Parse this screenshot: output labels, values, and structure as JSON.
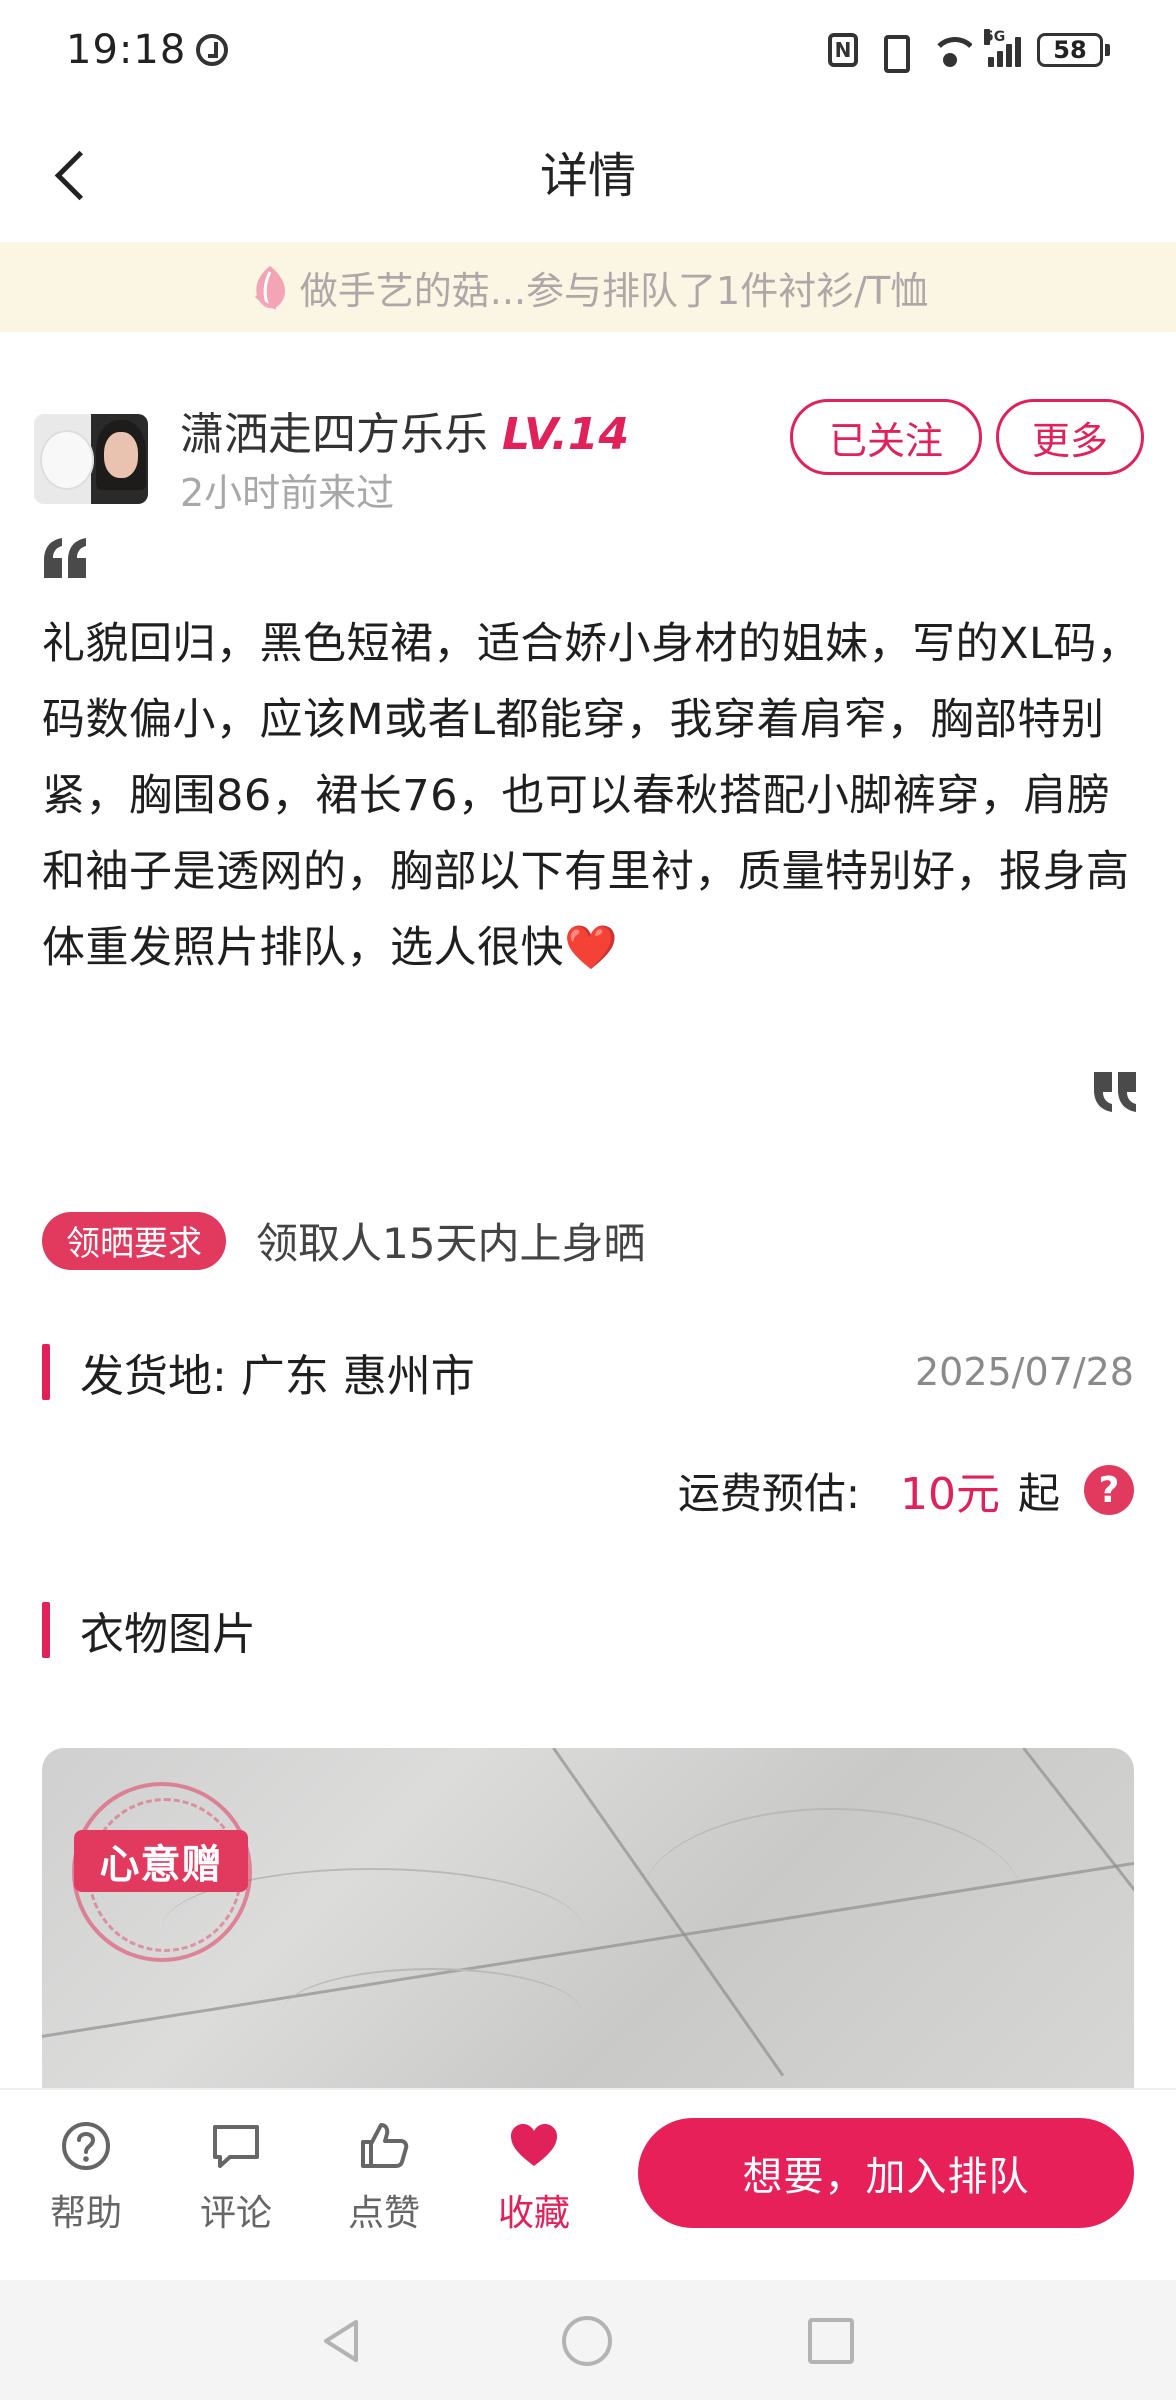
{
  "status_bar": {
    "time": "19:18",
    "network": "5G",
    "battery": "58"
  },
  "nav": {
    "title": "详情"
  },
  "notice": {
    "text": "做手艺的菇...参与排队了1件衬衫/T恤"
  },
  "user": {
    "name": "潇洒走四方乐乐",
    "level": "LV.14",
    "last_visit": "2小时前来过",
    "follow_label": "已关注",
    "more_label": "更多"
  },
  "post": {
    "body": "礼貌回归，黑色短裙，适合娇小身材的姐妹，写的XL码，码数偏小，应该M或者L都能穿，我穿着肩窄，胸部特别紧，胸围86，裙长76，也可以春秋搭配小脚裤穿，肩膀和袖子是透网的，胸部以下有里衬，质量特别好，报身高体重发照片排队，选人很快❤️"
  },
  "requirement": {
    "badge": "领晒要求",
    "text": "领取人15天内上身晒"
  },
  "shipping": {
    "label": "发货地:  广东 惠州市",
    "date": "2025/07/28",
    "fee_label": "运费预估:",
    "fee_amount": "10元",
    "fee_suffix": "起",
    "help_glyph": "?"
  },
  "photos": {
    "title": "衣物图片",
    "stamp_label": "心意赠"
  },
  "actions": {
    "help": "帮助",
    "comment": "评论",
    "like": "点赞",
    "favorite": "收藏",
    "primary": "想要，加入排队"
  },
  "colors": {
    "accent": "#e0215a",
    "notice_bg": "#fbf6e4",
    "badge": "#e23a5e"
  }
}
